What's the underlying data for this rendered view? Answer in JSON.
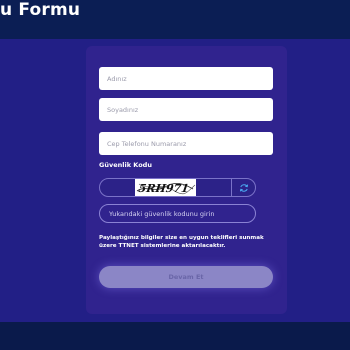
{
  "header": {
    "title": "u Formu"
  },
  "form": {
    "name_placeholder": "Adınız",
    "surname_placeholder": "Soyadınız",
    "phone_placeholder": "Cep Telefonu Numaranız",
    "security_label": "Güvenlik Kodu",
    "captcha_text": "5RH971",
    "captcha_input_placeholder": "Yukarıdaki güvenlik kodunu girin",
    "info_text": "Paylaştığınız bilgiler size en uygun teklifleri sunmak üzere TTNET sistemlerine aktarılacaktır.",
    "submit_label": "Devam Et"
  },
  "colors": {
    "background": "#221f86",
    "header": "#0b1e54",
    "card": "#30238e",
    "refresh_icon": "#4aa8f0"
  },
  "icons": {
    "refresh": "refresh-icon"
  }
}
